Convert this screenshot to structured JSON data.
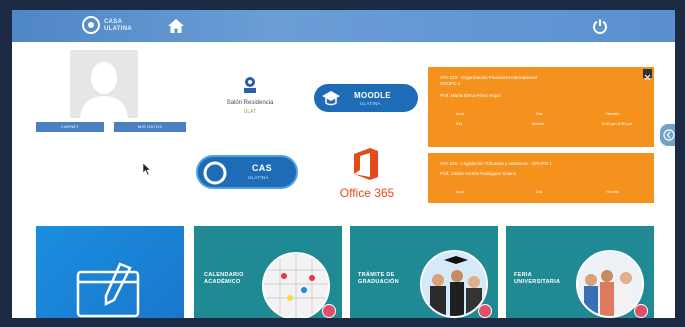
{
  "topbar": {
    "logo_text_line1": "CASA",
    "logo_text_line2": "ULATINA",
    "home_icon": "home-icon",
    "power_icon": "power-icon"
  },
  "profile": {
    "btn_left": "CARNET",
    "btn_right": "MIS DATOS"
  },
  "apps": {
    "salon_title": "Salón Residencia",
    "salon_sub": "ULAT",
    "moodle_title": "MOODLE",
    "moodle_sub": "ULATINA",
    "cas_title": "CAS",
    "cas_sub": "ULATINA",
    "office_title": "Office 365"
  },
  "courses": [
    {
      "line1": "ATA-123 - Organización Financiera Internacional",
      "line2": "GRUPO 1",
      "teacher": "Prof. María Elena Pérez Rojas",
      "h1": "Aula",
      "h2": "Día",
      "h3": "Horario",
      "v1": "B11",
      "v2": "Martes",
      "v3": "6:00 pm-9:50 pm"
    },
    {
      "line1": "ATA-345 - Legislación Tributaria y Aduanera - GRUPO 1",
      "line2": "",
      "teacher": "Prof. Carlos Andrés Rodríguez Solano",
      "h1": "Aula",
      "h2": "Día",
      "h3": "Horario",
      "v1": "",
      "v2": "",
      "v3": ""
    }
  ],
  "cards": [
    {
      "label": ""
    },
    {
      "label1": "CALENDARIO",
      "label2": "ACADÉMICO"
    },
    {
      "label1": "TRÁMITE DE",
      "label2": "GRADUACIÓN"
    },
    {
      "label1": "FERIA",
      "label2": "UNIVERSITARIA"
    }
  ],
  "colors": {
    "topbar": "#5a8fd0",
    "orange": "#f5921e",
    "teal": "#1f8a93",
    "blue_card": "#1b8ee0"
  }
}
